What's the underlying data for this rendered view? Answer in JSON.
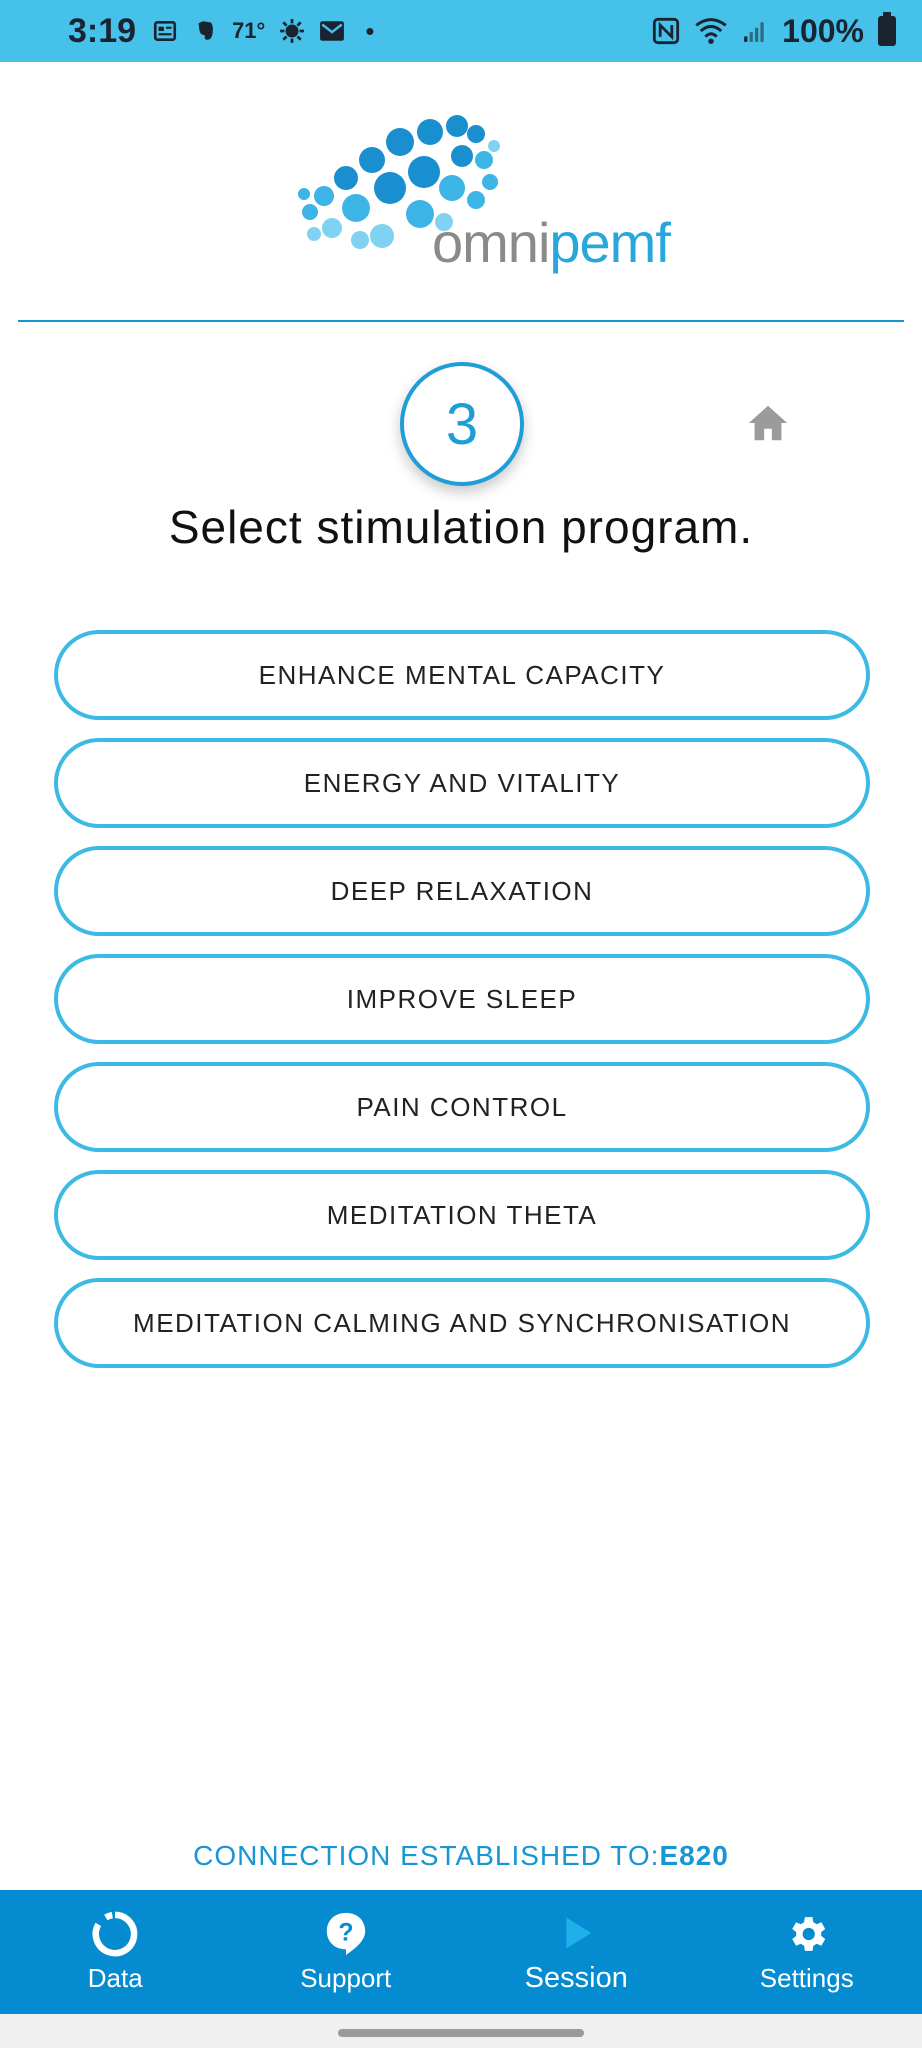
{
  "status_bar": {
    "time": "3:19",
    "temperature": "71°",
    "battery": "100%"
  },
  "logo": {
    "word_part1": "omni",
    "word_part2": "pemf"
  },
  "step": {
    "number": "3"
  },
  "title": "Select stimulation program.",
  "programs": [
    {
      "label": "ENHANCE MENTAL CAPACITY"
    },
    {
      "label": "ENERGY AND VITALITY"
    },
    {
      "label": "DEEP RELAXATION"
    },
    {
      "label": "IMPROVE SLEEP"
    },
    {
      "label": "PAIN CONTROL"
    },
    {
      "label": "MEDITATION THETA"
    },
    {
      "label": "MEDITATION CALMING AND SYNCHRONISATION"
    }
  ],
  "connection": {
    "prefix": "CONNECTION ESTABLISHED TO:",
    "device": "E820"
  },
  "bottom_nav": [
    {
      "label": "Data",
      "icon": "data-ring-icon"
    },
    {
      "label": "Support",
      "icon": "help-icon"
    },
    {
      "label": "Session",
      "icon": "play-icon",
      "active": true
    },
    {
      "label": "Settings",
      "icon": "gear-icon"
    }
  ],
  "colors": {
    "status_bar": "#46c1ea",
    "accent": "#1f9dd6",
    "button_border": "#3dbae3",
    "nav_background": "#048bd0"
  }
}
